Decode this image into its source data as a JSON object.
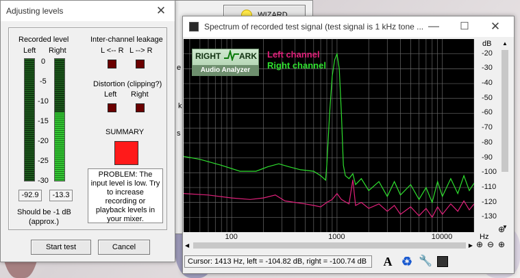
{
  "levels_dialog": {
    "title": "Adjusting levels",
    "recorded_level_label": "Recorded level",
    "left_label": "Left",
    "right_label": "Right",
    "scale": [
      "0",
      "-5",
      "-10",
      "-15",
      "-20",
      "-25",
      "-30"
    ],
    "left_value": "-92.9",
    "right_value": "-13.3",
    "left_meter_fraction": 0.0,
    "right_meter_fraction": 0.56,
    "should_be_text": "Should be  -1 dB",
    "approx_text": "(approx.)",
    "leakage_label": "Inter-channel leakage",
    "leakage_lr": "L <-- R",
    "leakage_rl": "L --> R",
    "distortion_label": "Distortion (clipping?)",
    "dist_left": "Left",
    "dist_right": "Right",
    "summary_label": "SUMMARY",
    "summary_color": "#ff1a1a",
    "indicator_color": "#6b0000",
    "problem_text": "PROBLEM: The input level is low. Try to increase recording or playback levels in your mixer.",
    "start_button": "Start test",
    "cancel_button": "Cancel"
  },
  "behind_window": {
    "wizard_label": "WIZARD",
    "partial_texts": [
      "e",
      "k",
      "s"
    ]
  },
  "spectrum_window": {
    "title": "Spectrum of recorded test signal (test signal is 1 kHz tone ...",
    "logo_line1_a": "RIGHT",
    "logo_line1_b": "ARK",
    "logo_line2": "Audio Analyzer",
    "legend_left": "Left channel",
    "legend_right": "Right channel",
    "left_color": "#e0207a",
    "right_color": "#2ee02e",
    "db_unit": "dB",
    "y_ticks": [
      "-20",
      "-30",
      "-40",
      "-50",
      "-60",
      "-70",
      "-80",
      "-90",
      "-100",
      "-110",
      "-120",
      "-130"
    ],
    "x_ticks": [
      "100",
      "1000",
      "10000"
    ],
    "hz_unit": "Hz",
    "cursor_text": "Cursor:  1413 Hz,  left = -104.82 dB,  right = -100.74 dB"
  }
}
